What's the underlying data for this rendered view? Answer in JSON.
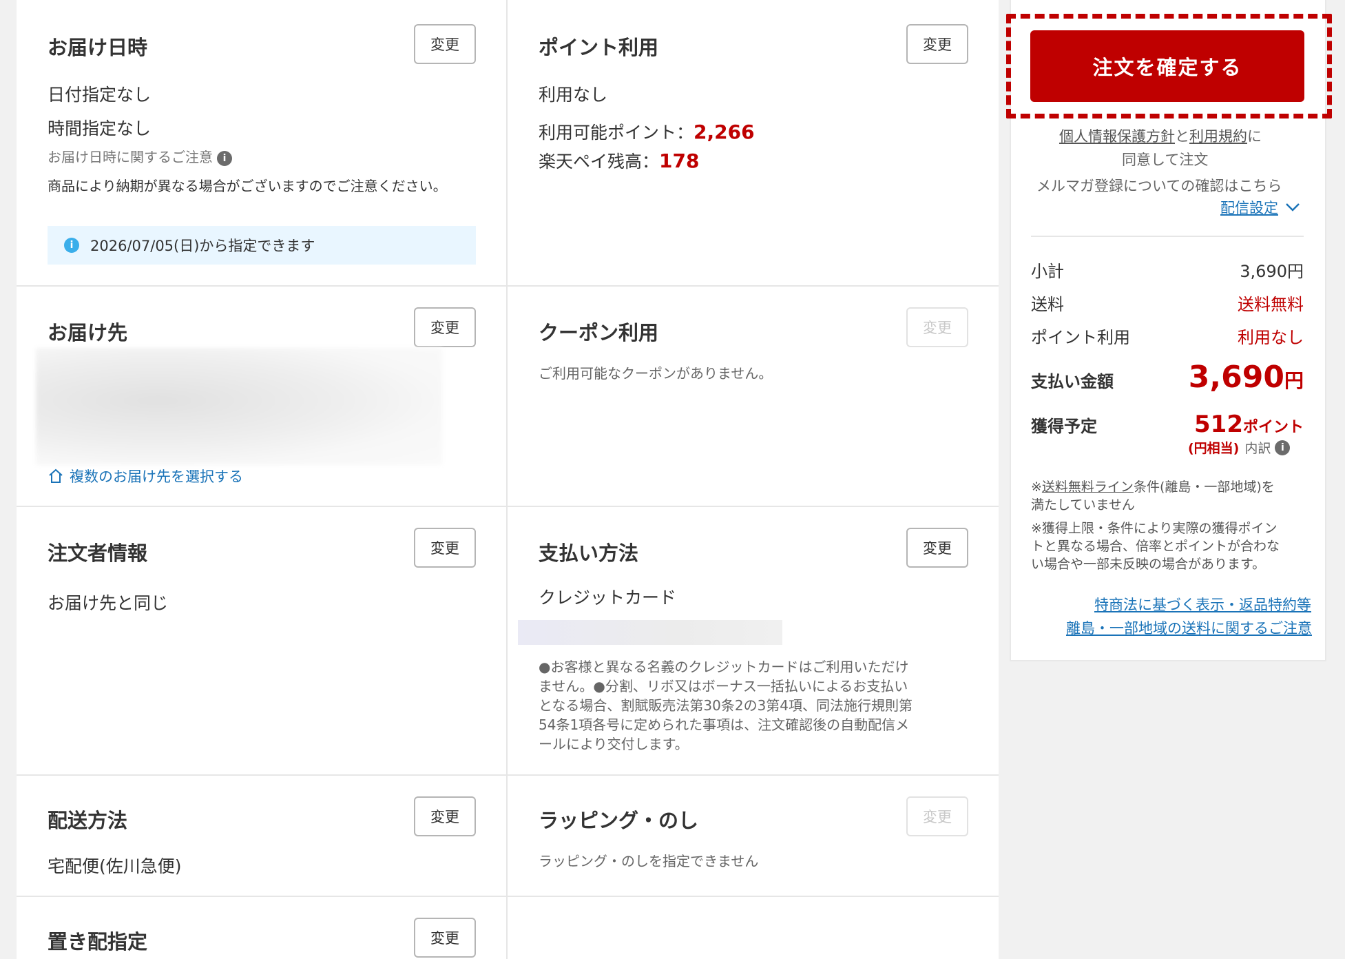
{
  "delivery_datetime": {
    "title": "お届け日時",
    "change_label": "変更",
    "date": "日付指定なし",
    "time": "時間指定なし",
    "caution_label": "お届け日時に関するご注意",
    "note": "商品により納期が異なる場合がございますのでご注意ください。",
    "available_from": "2026/07/05(日)から指定できます"
  },
  "points": {
    "title": "ポイント利用",
    "change_label": "変更",
    "usage": "利用なし",
    "available_label": "利用可能ポイント：",
    "available_value": "2,266",
    "pay_balance_label": "楽天ペイ残高：",
    "pay_balance_value": "178"
  },
  "delivery_address": {
    "title": "お届け先",
    "change_label": "変更",
    "multi_link": "複数のお届け先を選択する"
  },
  "coupon": {
    "title": "クーポン利用",
    "change_label": "変更",
    "message": "ご利用可能なクーポンがありません。"
  },
  "orderer": {
    "title": "注文者情報",
    "change_label": "変更",
    "value": "お届け先と同じ"
  },
  "payment": {
    "title": "支払い方法",
    "change_label": "変更",
    "method": "クレジットカード",
    "note_lines": [
      "●お客様と異なる名義のクレジットカードはご利用いただけ",
      "ません。●分割、リボ又はボーナス一括払いによるお支払い",
      "となる場合、割賦販売法第30条2の3第4項、同法施行規則第",
      "54条1項各号に定められた事項は、注文確認後の自動配信メ",
      "ールにより交付します。"
    ]
  },
  "shipping_method": {
    "title": "配送方法",
    "change_label": "変更",
    "value": "宅配便(佐川急便)"
  },
  "wrapping": {
    "title": "ラッピング・のし",
    "change_label": "変更",
    "message": "ラッピング・のしを指定できません"
  },
  "placement": {
    "title": "置き配指定",
    "change_label": "変更"
  },
  "side": {
    "confirm_button": "注文を確定する",
    "privacy_link": "個人情報保護方針",
    "and": "と",
    "terms_link": "利用規約",
    "ni": "に",
    "agree_text": "同意して注文",
    "mailmag_text": "メルマガ登録についての確認はこちら",
    "delivery_setting_link": "配信設定",
    "subtotal_label": "小計",
    "subtotal_value": "3,690円",
    "shipping_label": "送料",
    "shipping_value": "送料無料",
    "point_use_label": "ポイント利用",
    "point_use_value": "利用なし",
    "total_label": "支払い金額",
    "total_value": "3,690",
    "total_unit": "円",
    "earn_label": "獲得予定",
    "earn_value": "512",
    "earn_unit": "ポイント",
    "earn_equiv": "(円相当)",
    "earn_breakdown": "内訳",
    "note1_link": "送料無料ライン",
    "note1_prefix": "※",
    "note1_line1_rest": "条件(離島・一部地域)を",
    "note1_line2": "満たしていません",
    "note2_lines": [
      "※獲得上限・条件により実際の獲得ポイン",
      "トと異なる場合、倍率とポイントが合わな",
      "い場合や一部未反映の場合があります。"
    ],
    "law_link": "特商法に基づく表示・返品特約等",
    "remote_link": "離島・一部地域の送料に関するご注意"
  },
  "colors": {
    "accent_red": "#bf0000",
    "link_blue": "#1a73b8",
    "info_bg": "#e9f6ff"
  }
}
